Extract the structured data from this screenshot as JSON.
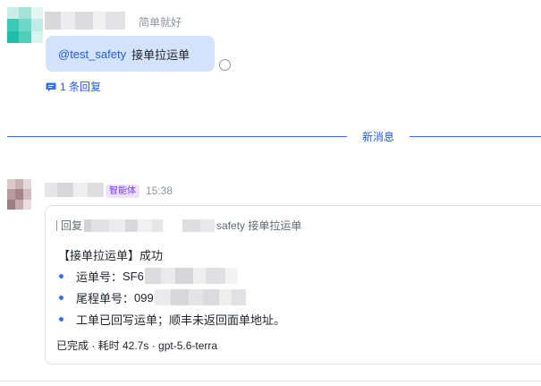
{
  "message_1": {
    "meta_text": "简单就好",
    "mention": "@test_safety",
    "body_text": "接单拉运单",
    "reply_count_label": "1 条回复"
  },
  "divider": {
    "label": "新消息"
  },
  "message_2": {
    "badge": "智能体",
    "time": "15:38",
    "quote": {
      "prefix": "回复",
      "suffix": "safety 接单拉运单"
    },
    "result_title": "【接单拉运单】成功",
    "items": [
      {
        "label": "运单号：",
        "value": "SF6"
      },
      {
        "label": "尾程单号：",
        "value": "099"
      },
      {
        "label": "工单已回写运单；顺丰未返回面单地址。",
        "value": ""
      }
    ],
    "status_text": "已完成 · 耗时 42.7s · gpt-5.6-terra"
  },
  "colors": {
    "accent": "#3370ff",
    "mention_text": "#245bdb",
    "bubble_bg": "#d4e3fc",
    "badge_bg": "#ece2fe",
    "badge_text": "#7f3bf5",
    "muted_text": "#8f959e"
  },
  "icons": {
    "reply": "comment-icon",
    "read_status": "unread-ring-icon"
  }
}
